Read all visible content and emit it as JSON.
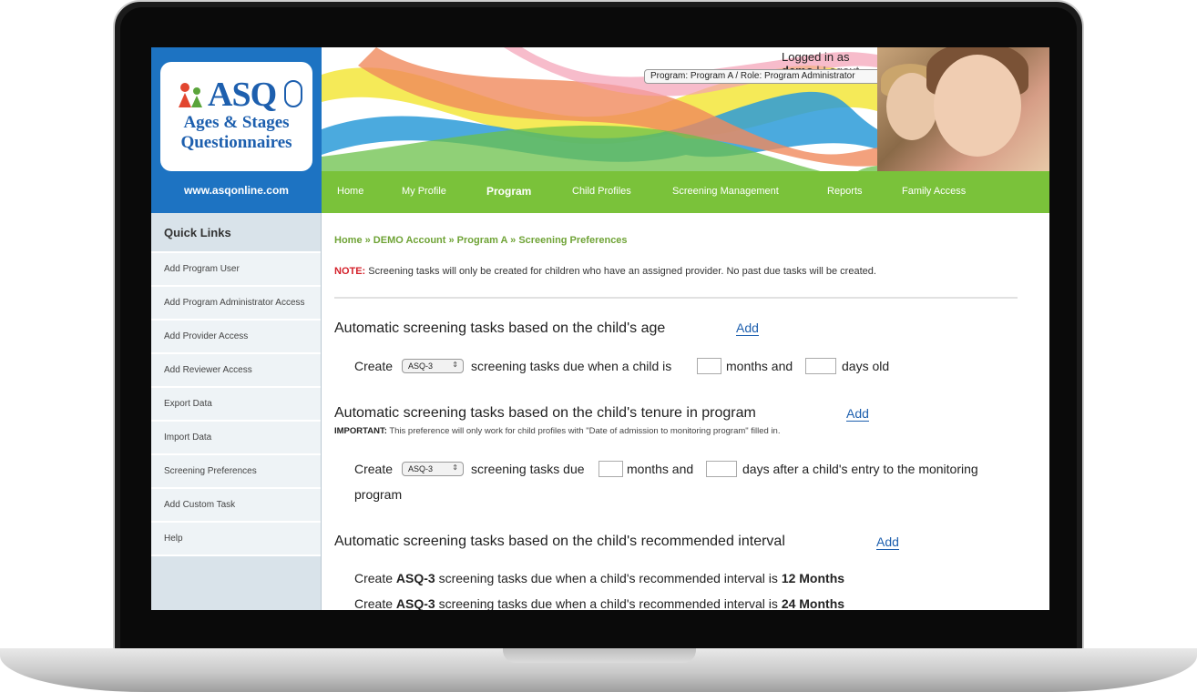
{
  "header": {
    "logo_text": "ASQ",
    "logo_tagline_1": "Ages & Stages",
    "logo_tagline_2": "Questionnaires",
    "site_url": "www.asqonline.com",
    "logged_in_prefix": "Logged in as",
    "username": "demo",
    "separator": "|",
    "logout_label": "Logout",
    "program_select_value": "Program: Program A / Role: Program Administrator"
  },
  "nav": {
    "items": [
      "Home",
      "My Profile",
      "Program",
      "Child Profiles",
      "Screening Management",
      "Reports",
      "Family Access"
    ],
    "active": "Program"
  },
  "sidebar": {
    "title": "Quick Links",
    "items": [
      "Add Program User",
      "Add Program Administrator Access",
      "Add Provider Access",
      "Add Reviewer Access",
      "Export Data",
      "Import Data",
      "Screening Preferences",
      "Add Custom Task",
      "Help"
    ]
  },
  "main": {
    "breadcrumb": "Home » DEMO Account » Program A » Screening Preferences",
    "note_label": "NOTE:",
    "note_text": " Screening tasks will only be created for children who have an assigned provider. No past due tasks will be created.",
    "sections": {
      "age": {
        "title": "Automatic screening tasks based on the child's age",
        "add_label": "Add",
        "create_label": "Create",
        "select_value": "ASQ-3",
        "text_1": "screening tasks due when a child is",
        "text_2": "months and",
        "text_3": "days old"
      },
      "tenure": {
        "title": "Automatic screening tasks based on the child's tenure in program",
        "add_label": "Add",
        "important_label": "IMPORTANT:",
        "important_text": " This preference will only work for child profiles with \"Date of admission to monitoring program\" filled in.",
        "create_label": "Create",
        "select_value": "ASQ-3",
        "text_1": "screening tasks due",
        "text_2": "months and",
        "text_3": "days after a child's entry to the monitoring",
        "text_4": "program"
      },
      "interval": {
        "title": "Automatic screening tasks based on the child's recommended interval",
        "add_label": "Add",
        "rows": [
          {
            "create": "Create",
            "tool": "ASQ-3",
            "middle": "screening tasks due when a child's recommended interval is",
            "value": "12 Months"
          },
          {
            "create": "Create",
            "tool": "ASQ-3",
            "middle": "screening tasks due when a child's recommended interval is",
            "value": "24 Months"
          }
        ]
      }
    }
  },
  "colors": {
    "nav_green": "#7ac23a",
    "logo_blue": "#1d73c2",
    "link_blue": "#1d5fae",
    "note_red": "#d4212b",
    "breadcrumb_green": "#6fa336",
    "sidebar_bg": "#d9e3ea"
  }
}
